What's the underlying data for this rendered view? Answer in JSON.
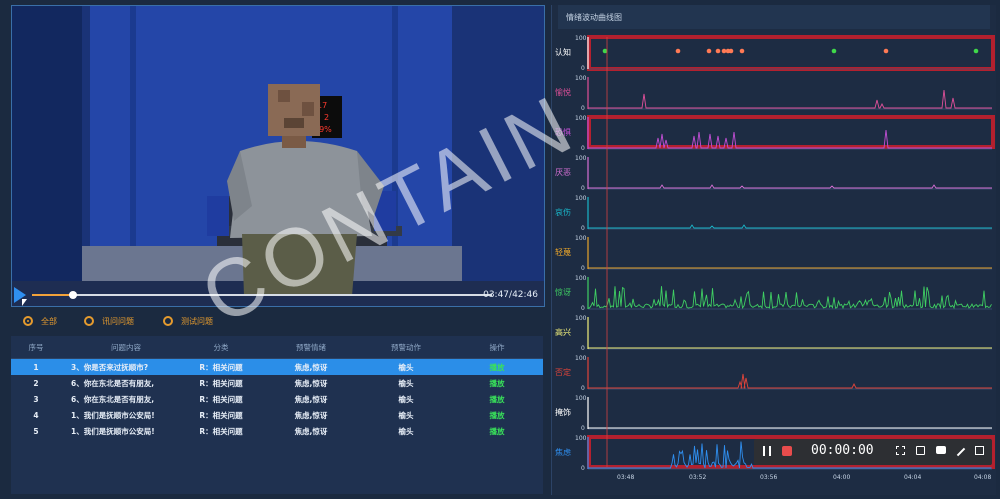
{
  "video": {
    "time_readout": "03:47/42:46",
    "progress_fraction": 0.089,
    "display_panel": {
      "line1": "17",
      "line2": "2",
      "line3": "49%"
    }
  },
  "filters": {
    "items": [
      {
        "label": "全部",
        "checked": true
      },
      {
        "label": "讯问问题",
        "checked": false
      },
      {
        "label": "测试问题",
        "checked": false
      }
    ]
  },
  "question_table": {
    "headers": [
      "序号",
      "问题内容",
      "分类",
      "预警情绪",
      "预警动作",
      "操作"
    ],
    "rows": [
      {
        "index": "1",
        "question": "3、你是否来过抚顺市?",
        "category": "R：相关问题",
        "emotion": "焦虑,惊讶",
        "action": "榆头",
        "op": "播放",
        "selected": true
      },
      {
        "index": "2",
        "question": "6、你在东北是否有朋友,",
        "category": "R：相关问题",
        "emotion": "焦虑,惊讶",
        "action": "榆头",
        "op": "播放",
        "selected": false
      },
      {
        "index": "3",
        "question": "6、你在东北是否有朋友,",
        "category": "R：相关问题",
        "emotion": "焦虑,惊讶",
        "action": "榆头",
        "op": "播放",
        "selected": false
      },
      {
        "index": "4",
        "question": "1、我们是抚顺市公安局!",
        "category": "R：相关问题",
        "emotion": "焦虑,惊讶",
        "action": "榆头",
        "op": "播放",
        "selected": false
      },
      {
        "index": "5",
        "question": "1、我们是抚顺市公安局!",
        "category": "R：相关问题",
        "emotion": "焦虑,惊讶",
        "action": "榆头",
        "op": "播放",
        "selected": false
      }
    ]
  },
  "emotion_panel": {
    "title": "情绪波动曲线图",
    "y_tick_top": "100",
    "y_tick_bottom": "0",
    "x_labels": [
      "03:48",
      "03:52",
      "03:56",
      "04:00",
      "04:04",
      "04:08"
    ],
    "tracks": [
      {
        "name": "认知",
        "color": "#ffffff",
        "kind": "dots",
        "alert": true
      },
      {
        "name": "愉悦",
        "color": "#e0509a",
        "kind": "line",
        "alert": false
      },
      {
        "name": "恐惧",
        "color": "#c24fd6",
        "kind": "line",
        "alert": true
      },
      {
        "name": "厌恶",
        "color": "#d66fd6",
        "kind": "line",
        "alert": false
      },
      {
        "name": "哀伤",
        "color": "#19b6c9",
        "kind": "line",
        "alert": false
      },
      {
        "name": "轻蔑",
        "color": "#e8a42b",
        "kind": "line",
        "alert": false
      },
      {
        "name": "惊讶",
        "color": "#3fcf63",
        "kind": "line",
        "alert": false
      },
      {
        "name": "高兴",
        "color": "#f2f07a",
        "kind": "line",
        "alert": false
      },
      {
        "name": "否定",
        "color": "#e0443a",
        "kind": "line",
        "alert": false
      },
      {
        "name": "掩饰",
        "color": "#ffffff",
        "kind": "line",
        "alert": false
      },
      {
        "name": "焦虑",
        "color": "#2f8ff0",
        "kind": "line",
        "alert": true
      }
    ]
  },
  "recorder": {
    "clock": "00:00:00"
  },
  "watermark": "CONTAIN"
}
